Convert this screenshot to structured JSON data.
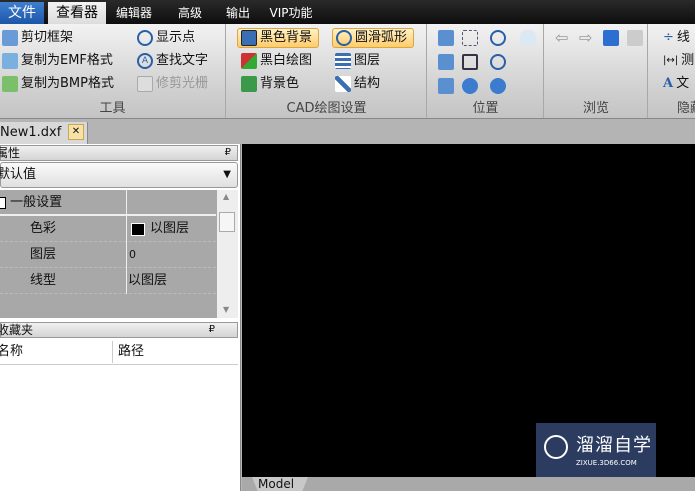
{
  "menu": {
    "file": "文件",
    "tabs": [
      "查看器",
      "编辑器",
      "高级",
      "输出",
      "VIP功能"
    ]
  },
  "ribbon": {
    "tools": {
      "label": "工具",
      "items": [
        "剪切框架",
        "复制为EMF格式",
        "复制为BMP格式",
        "显示点",
        "查找文字",
        "修剪光栅"
      ]
    },
    "cad": {
      "label": "CAD绘图设置",
      "items": [
        "黑色背景",
        "黑白绘图",
        "背景色",
        "圆滑弧形",
        "图层",
        "结构"
      ]
    },
    "position": {
      "label": "位置"
    },
    "browse": {
      "label": "浏览"
    },
    "hide": {
      "label": "隐藏",
      "items": [
        "线",
        "测",
        "文"
      ]
    }
  },
  "doc_tab": "New1.dxf",
  "properties": {
    "title": "属性",
    "dropdown": "默认值",
    "section": "一般设置",
    "rows": [
      {
        "name": "色彩",
        "value": "以图层"
      },
      {
        "name": "图层",
        "value": "0"
      },
      {
        "name": "线型",
        "value": "以图层"
      }
    ]
  },
  "favorites": {
    "title": "收藏夹",
    "columns": [
      "名称",
      "路径"
    ]
  },
  "model_tab": "Model",
  "watermark": {
    "name": "溜溜自学",
    "url": "ZIXUE.3D66.COM"
  }
}
